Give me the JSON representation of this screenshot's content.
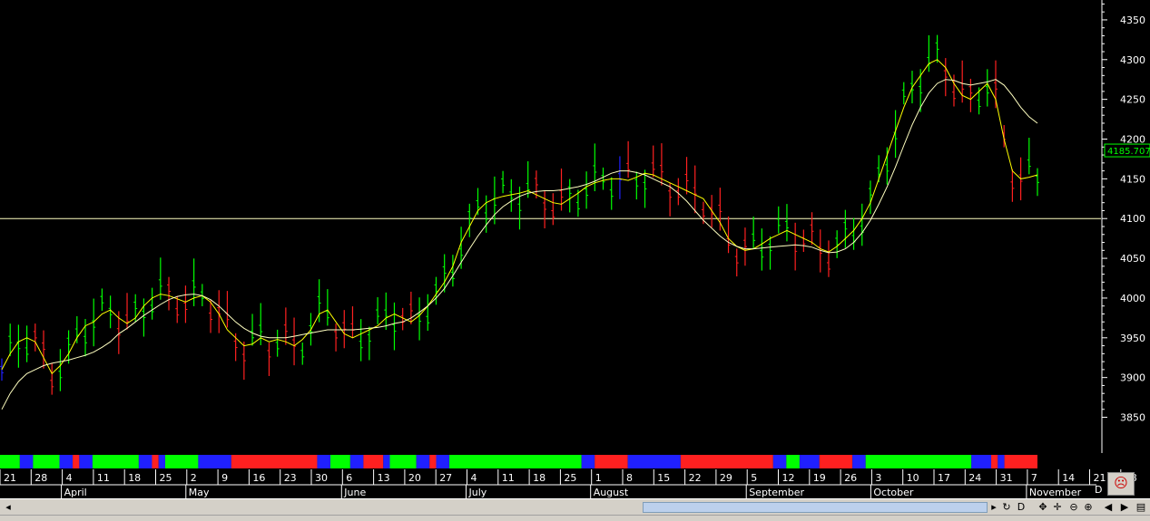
{
  "chart_data": {
    "type": "bar",
    "subtype": "ohlc-with-moving-averages",
    "title": "",
    "xlabel": "",
    "ylabel": "",
    "ylim": [
      3805,
      4375
    ],
    "y_ticks": [
      3850,
      3900,
      3950,
      4000,
      4050,
      4100,
      4150,
      4200,
      4250,
      4300,
      4350
    ],
    "last_price": "4185.707",
    "horizontal_line": 4100,
    "trendline": [
      [
        165,
        3852
      ],
      [
        481,
        4105
      ]
    ],
    "series": [
      {
        "name": "",
        "color": "#ffff00",
        "values": [
          3910,
          3930,
          3945,
          3950,
          3945,
          3925,
          3905,
          3915,
          3930,
          3950,
          3965,
          3970,
          3980,
          3985,
          3975,
          3968,
          3975,
          3990,
          4000,
          4005,
          4003,
          3999,
          3995,
          4000,
          4003,
          3995,
          3980,
          3960,
          3950,
          3940,
          3942,
          3950,
          3945,
          3948,
          3945,
          3940,
          3948,
          3960,
          3980,
          3985,
          3970,
          3955,
          3950,
          3955,
          3960,
          3965,
          3975,
          3980,
          3975,
          3970,
          3978,
          3990,
          4005,
          4020,
          4040,
          4070,
          4090,
          4110,
          4120,
          4125,
          4128,
          4130,
          4132,
          4135,
          4130,
          4125,
          4120,
          4118,
          4125,
          4132,
          4140,
          4145,
          4148,
          4150,
          4150,
          4148,
          4152,
          4157,
          4155,
          4150,
          4145,
          4140,
          4135,
          4130,
          4125,
          4110,
          4095,
          4075,
          4065,
          4060,
          4062,
          4068,
          4075,
          4080,
          4085,
          4080,
          4075,
          4070,
          4062,
          4058,
          4065,
          4075,
          4085,
          4100,
          4120,
          4150,
          4180,
          4210,
          4240,
          4265,
          4280,
          4295,
          4300,
          4290,
          4270,
          4255,
          4250,
          4260,
          4270,
          4250,
          4200,
          4160,
          4150,
          4152,
          4155
        ]
      },
      {
        "name": "",
        "color": "#ffffc0",
        "values": [
          3860,
          3880,
          3895,
          3905,
          3910,
          3915,
          3918,
          3920,
          3922,
          3925,
          3928,
          3932,
          3938,
          3945,
          3955,
          3962,
          3970,
          3978,
          3985,
          3992,
          3998,
          4002,
          4004,
          4005,
          4003,
          3998,
          3990,
          3980,
          3970,
          3962,
          3956,
          3952,
          3950,
          3950,
          3950,
          3952,
          3954,
          3956,
          3958,
          3960,
          3960,
          3960,
          3960,
          3961,
          3962,
          3963,
          3965,
          3968,
          3970,
          3975,
          3982,
          3990,
          4000,
          4012,
          4028,
          4045,
          4062,
          4078,
          4092,
          4105,
          4115,
          4122,
          4128,
          4132,
          4134,
          4135,
          4135,
          4136,
          4138,
          4140,
          4143,
          4147,
          4152,
          4157,
          4160,
          4160,
          4158,
          4155,
          4150,
          4145,
          4140,
          4132,
          4122,
          4110,
          4098,
          4088,
          4078,
          4070,
          4065,
          4062,
          4062,
          4063,
          4064,
          4065,
          4066,
          4067,
          4066,
          4064,
          4060,
          4057,
          4058,
          4062,
          4070,
          4082,
          4098,
          4118,
          4140,
          4165,
          4192,
          4218,
          4240,
          4258,
          4270,
          4275,
          4274,
          4270,
          4268,
          4270,
          4272,
          4275,
          4268,
          4255,
          4240,
          4228,
          4220
        ]
      },
      {
        "name": "",
        "color": "#2020ff",
        "values": []
      }
    ],
    "x_ticks": [
      "21",
      "28",
      "4",
      "11",
      "18",
      "25",
      "2",
      "9",
      "16",
      "23",
      "30",
      "6",
      "13",
      "20",
      "27",
      "4",
      "11",
      "18",
      "25",
      "1",
      "8",
      "15",
      "22",
      "29",
      "5",
      "12",
      "19",
      "26",
      "3",
      "10",
      "17",
      "24",
      "31",
      "7",
      "14",
      "21",
      "28"
    ],
    "months": [
      "April",
      "May",
      "June",
      "July",
      "August",
      "September",
      "October",
      "November"
    ],
    "trend_segments": [
      {
        "state": "green",
        "from": 0,
        "to": 3
      },
      {
        "state": "blue",
        "from": 3,
        "to": 5
      },
      {
        "state": "green",
        "from": 5,
        "to": 9
      },
      {
        "state": "blue",
        "from": 9,
        "to": 11
      },
      {
        "state": "red",
        "from": 11,
        "to": 12
      },
      {
        "state": "blue",
        "from": 12,
        "to": 14
      },
      {
        "state": "green",
        "from": 14,
        "to": 21
      },
      {
        "state": "blue",
        "from": 21,
        "to": 23
      },
      {
        "state": "red",
        "from": 23,
        "to": 24
      },
      {
        "state": "blue",
        "from": 24,
        "to": 25
      },
      {
        "state": "green",
        "from": 25,
        "to": 30
      },
      {
        "state": "blue",
        "from": 30,
        "to": 35
      },
      {
        "state": "red",
        "from": 35,
        "to": 48
      },
      {
        "state": "blue",
        "from": 48,
        "to": 50
      },
      {
        "state": "green",
        "from": 50,
        "to": 53
      },
      {
        "state": "blue",
        "from": 53,
        "to": 55
      },
      {
        "state": "red",
        "from": 55,
        "to": 58
      },
      {
        "state": "blue",
        "from": 58,
        "to": 59
      },
      {
        "state": "green",
        "from": 59,
        "to": 63
      },
      {
        "state": "blue",
        "from": 63,
        "to": 65
      },
      {
        "state": "red",
        "from": 65,
        "to": 66
      },
      {
        "state": "blue",
        "from": 66,
        "to": 68
      },
      {
        "state": "green",
        "from": 68,
        "to": 88
      },
      {
        "state": "blue",
        "from": 88,
        "to": 90
      },
      {
        "state": "red",
        "from": 90,
        "to": 95
      },
      {
        "state": "blue",
        "from": 95,
        "to": 103
      },
      {
        "state": "red",
        "from": 103,
        "to": 117
      },
      {
        "state": "blue",
        "from": 117,
        "to": 119
      },
      {
        "state": "green",
        "from": 119,
        "to": 121
      },
      {
        "state": "blue",
        "from": 121,
        "to": 124
      },
      {
        "state": "red",
        "from": 124,
        "to": 129
      },
      {
        "state": "blue",
        "from": 129,
        "to": 131
      },
      {
        "state": "green",
        "from": 131,
        "to": 147
      },
      {
        "state": "blue",
        "from": 147,
        "to": 150
      },
      {
        "state": "red",
        "from": 150,
        "to": 151
      },
      {
        "state": "blue",
        "from": 151,
        "to": 152
      },
      {
        "state": "red",
        "from": 152,
        "to": 157
      }
    ],
    "grid": false,
    "legend": "none"
  },
  "colors": {
    "up": "#00ff00",
    "down": "#ff2020",
    "neutral": "#2020ff",
    "hline": "#ffffc0",
    "trend": "#ffffc0"
  },
  "ui": {
    "date_label_extra": "D",
    "icons": [
      "refresh-icon",
      "day-icon",
      "move-icon",
      "crosshair-icon",
      "zoom-out-icon",
      "zoom-in-icon",
      "prev-icon",
      "next-icon",
      "fit-icon"
    ]
  }
}
